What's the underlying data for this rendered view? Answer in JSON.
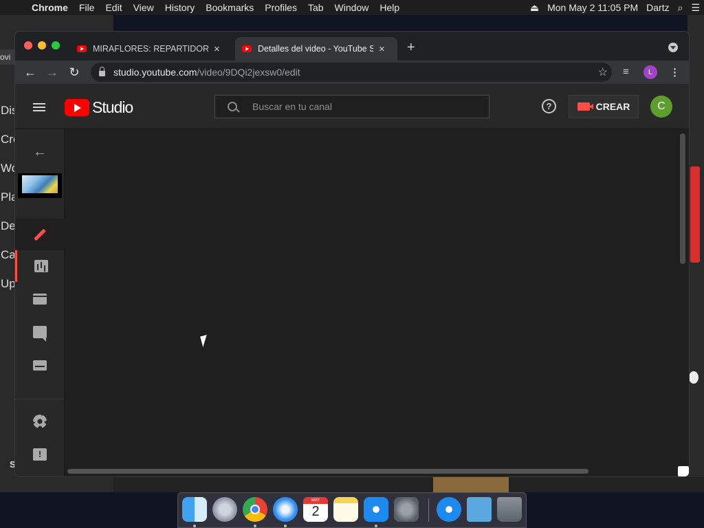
{
  "menubar": {
    "apple": "",
    "items": [
      "Chrome",
      "File",
      "Edit",
      "View",
      "History",
      "Bookmarks",
      "Profiles",
      "Tab",
      "Window",
      "Help"
    ],
    "eject": "⏏",
    "clock": "Mon May 2  11:05 PM",
    "user": "Dartz",
    "search_icon": "⌕",
    "list_icon": "☰"
  },
  "background_window": {
    "partial_items": [
      "Dis",
      "Cre",
      "Wo",
      "Pla",
      "De",
      "Ca",
      "Up"
    ],
    "top_fragment": "ovi",
    "bottom_fragment": "S"
  },
  "browser": {
    "tabs": [
      {
        "title": "MIRAFLORES: REPARTIDOR HA",
        "close": "×"
      },
      {
        "title": "Detalles del video - YouTube St",
        "close": "×"
      }
    ],
    "new_tab": "+",
    "url_host": "studio.youtube.com",
    "url_path": "/video/9DQi2jexsw0/edit",
    "star": "☆",
    "profile_initial": "L",
    "menu": "⋮",
    "queue": "≡"
  },
  "studio": {
    "logo_text": "Studio",
    "search_placeholder": "Buscar en tu canal",
    "help": "?",
    "create_label": "CREAR",
    "avatar_initial": "C",
    "back": "←"
  },
  "dock": {
    "calendar_month": "MAY",
    "calendar_day": "2"
  },
  "colors": {
    "accent_red": "#ff4e45",
    "youtube_red": "#ff0000",
    "avatar_green": "#5e9e2b",
    "profile_purple": "#a142c8"
  }
}
